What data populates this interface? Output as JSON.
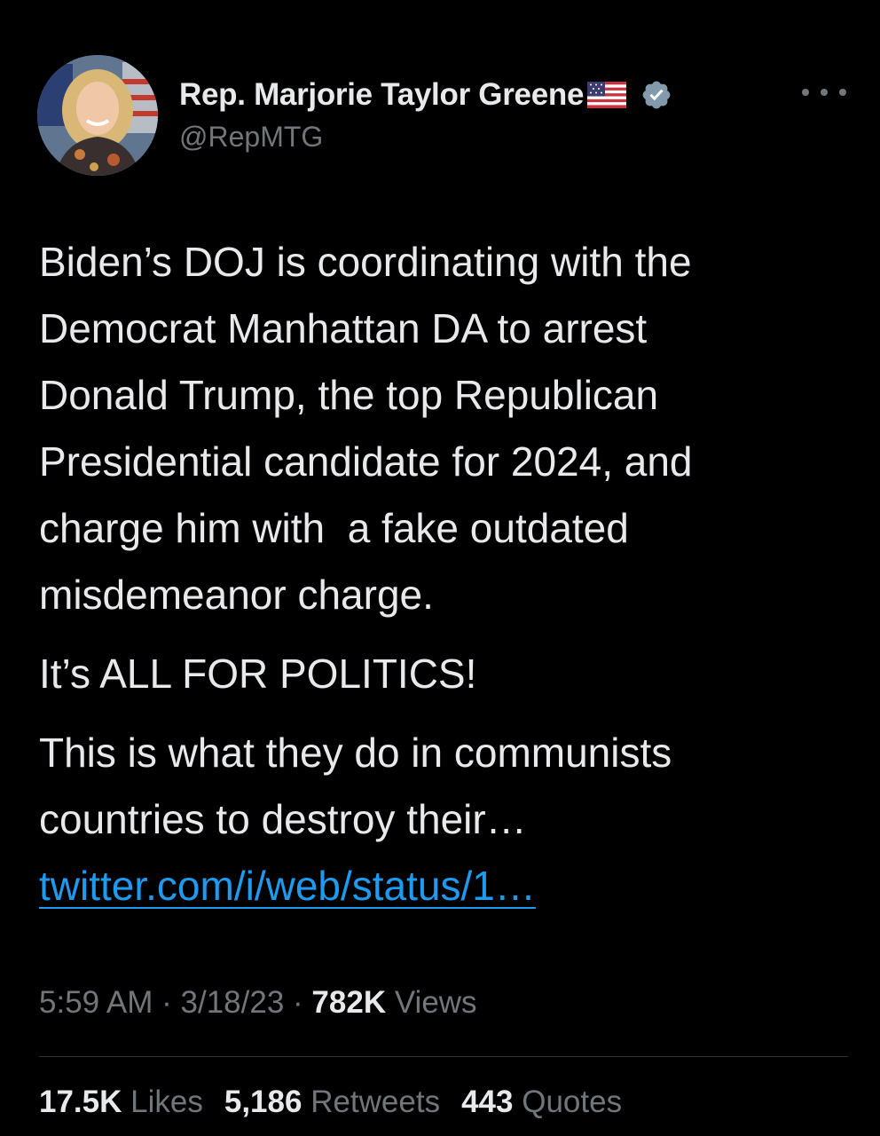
{
  "author": {
    "display_name": "Rep. Marjorie Taylor Greene",
    "handle": "@RepMTG",
    "badge_icon": "verified-badge-icon",
    "flag_icon": "us-flag-icon"
  },
  "tweet": {
    "paragraphs": [
      "Biden’s DOJ is coordinating with the\nDemocrat Manhattan DA to arrest\nDonald Trump, the top Republican\nPresidential candidate for 2024, and\ncharge him with  a fake outdated\nmisdemeanor charge.",
      "It’s ALL FOR POLITICS!",
      "This is what they do in communists\ncountries to destroy their…"
    ],
    "link": "twitter.com/i/web/status/1…"
  },
  "meta": {
    "time": "5:59 AM",
    "separator": " · ",
    "date": "3/18/23",
    "views_count": "782K",
    "views_label": "Views"
  },
  "stats": {
    "likes_count": "17.5K",
    "likes_label": "Likes",
    "retweets_count": "5,186",
    "retweets_label": "Retweets",
    "quotes_count": "443",
    "quotes_label": "Quotes"
  },
  "colors": {
    "background": "#000000",
    "text": "#e7e9ea",
    "secondary": "#71767b",
    "link": "#1d9bf0",
    "verified": "#829aab"
  }
}
